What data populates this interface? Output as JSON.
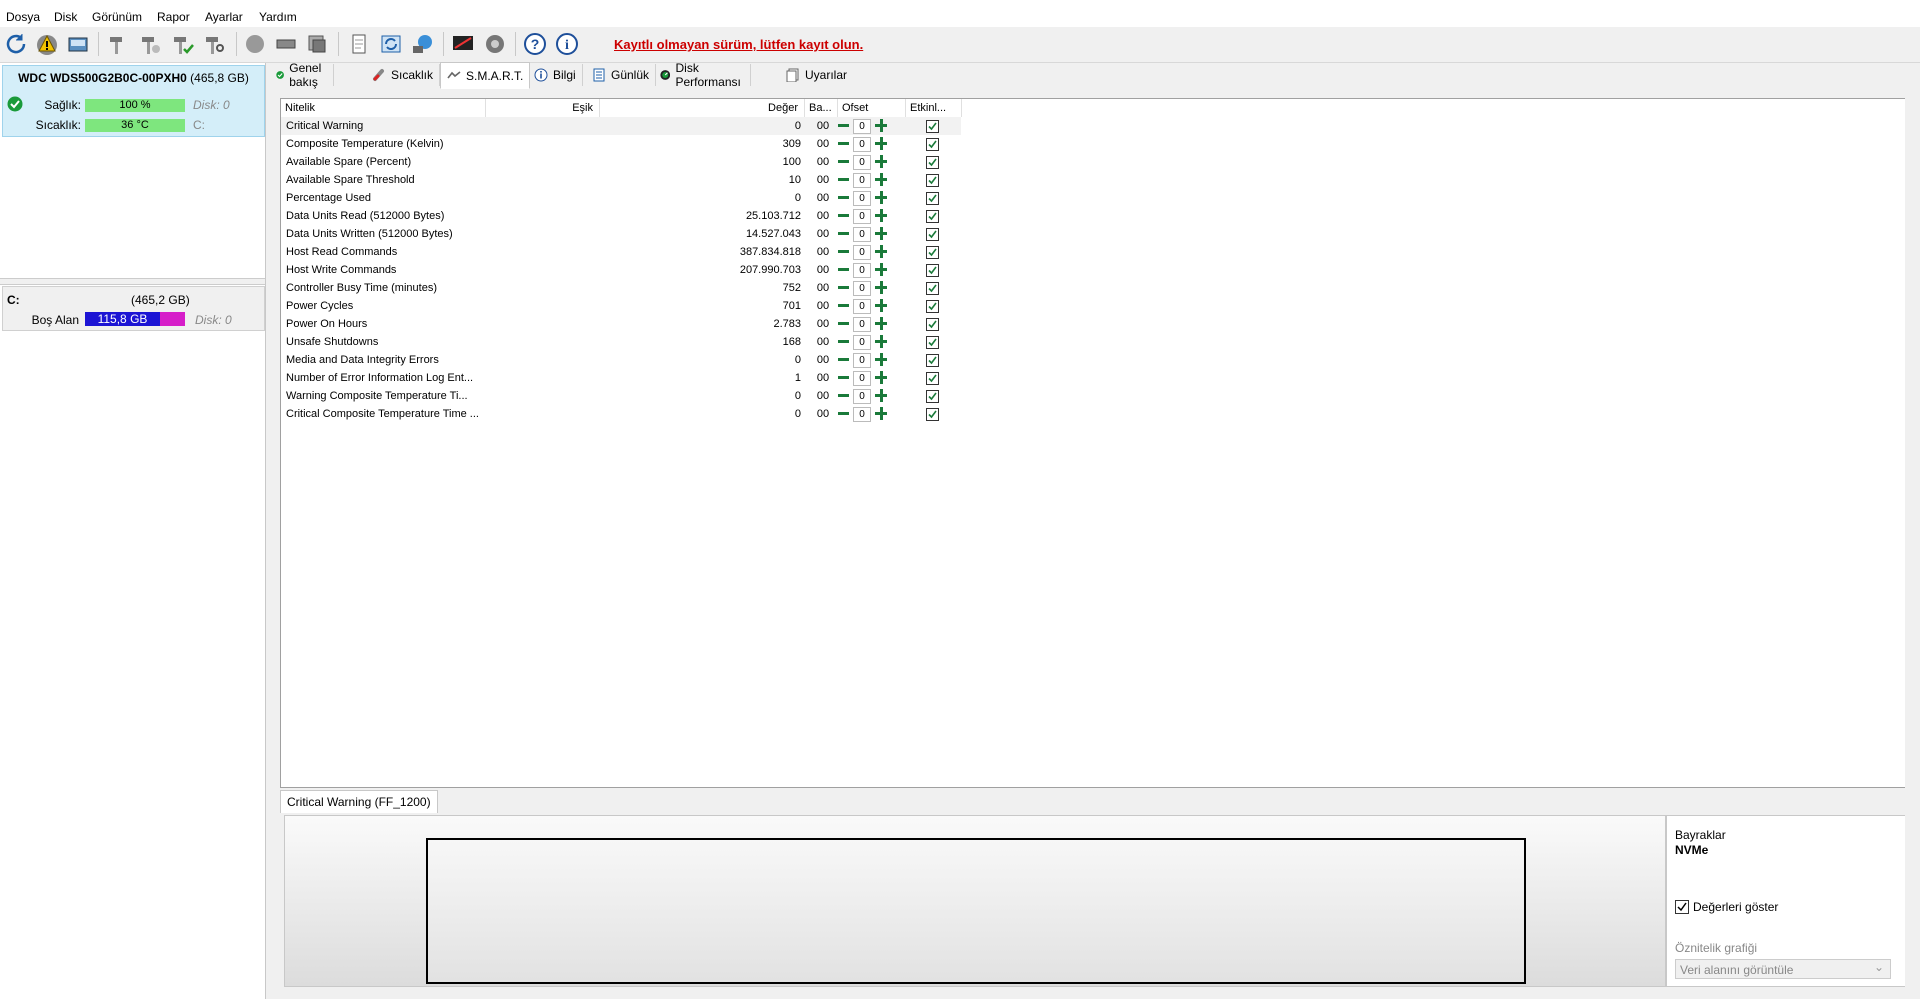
{
  "menu": [
    "Dosya",
    "Disk",
    "Görünüm",
    "Rapor",
    "Ayarlar",
    "Yardım"
  ],
  "unregistered": "Kayıtlı olmayan sürüm, lütfen kayıt olun.",
  "disk": {
    "model": "WDC WDS500G2B0C-00PXH0",
    "size": "(465,8 GB)",
    "health_label": "Sağlık:",
    "health_value": "100 %",
    "temp_label": "Sıcaklık:",
    "temp_value": "36 °C",
    "disk_num": "Disk: 0",
    "drive": "C:"
  },
  "volume": {
    "letter": "C:",
    "size": "(465,2 GB)",
    "free_label": "Boş Alan",
    "free_value": "115,8 GB",
    "used_fraction": 0.75,
    "disk_num": "Disk: 0"
  },
  "tabs": [
    "Genel bakış",
    "Sıcaklık",
    "S.M.A.R.T.",
    "Bilgi",
    "Günlük",
    "Disk Performansı",
    "Uyarılar"
  ],
  "table": {
    "headers": [
      "Nitelik",
      "Eşik",
      "Değer",
      "Ba...",
      "Ofset",
      "Etkinl..."
    ],
    "rows": [
      {
        "name": "Critical Warning",
        "value": "0",
        "ba": "00",
        "offset": "0"
      },
      {
        "name": "Composite Temperature (Kelvin)",
        "value": "309",
        "ba": "00",
        "offset": "0"
      },
      {
        "name": "Available Spare (Percent)",
        "value": "100",
        "ba": "00",
        "offset": "0"
      },
      {
        "name": "Available Spare Threshold",
        "value": "10",
        "ba": "00",
        "offset": "0"
      },
      {
        "name": "Percentage Used",
        "value": "0",
        "ba": "00",
        "offset": "0"
      },
      {
        "name": "Data Units Read (512000 Bytes)",
        "value": "25.103.712",
        "ba": "00",
        "offset": "0"
      },
      {
        "name": "Data Units Written (512000 Bytes)",
        "value": "14.527.043",
        "ba": "00",
        "offset": "0"
      },
      {
        "name": "Host Read Commands",
        "value": "387.834.818",
        "ba": "00",
        "offset": "0"
      },
      {
        "name": "Host Write Commands",
        "value": "207.990.703",
        "ba": "00",
        "offset": "0"
      },
      {
        "name": "Controller Busy Time (minutes)",
        "value": "752",
        "ba": "00",
        "offset": "0"
      },
      {
        "name": "Power Cycles",
        "value": "701",
        "ba": "00",
        "offset": "0"
      },
      {
        "name": "Power On Hours",
        "value": "2.783",
        "ba": "00",
        "offset": "0"
      },
      {
        "name": "Unsafe Shutdowns",
        "value": "168",
        "ba": "00",
        "offset": "0"
      },
      {
        "name": "Media and Data Integrity Errors",
        "value": "0",
        "ba": "00",
        "offset": "0"
      },
      {
        "name": "Number of Error Information Log Ent...",
        "value": "1",
        "ba": "00",
        "offset": "0"
      },
      {
        "name": "Warning Composite Temperature Ti...",
        "value": "0",
        "ba": "00",
        "offset": "0"
      },
      {
        "name": "Critical Composite Temperature Time ...",
        "value": "0",
        "ba": "00",
        "offset": "0"
      }
    ]
  },
  "bottom": {
    "tab_label": "Critical Warning (FF_1200)",
    "flags_label": "Bayraklar",
    "flags_value": "NVMe",
    "show_values_label": "Değerleri göster",
    "attr_graph_label": "Öznitelik grafiği",
    "dropdown_value": "Veri alanını görüntüle"
  },
  "colors": {
    "health_bar": "#7ee67e",
    "used_bar": "#1c14d4",
    "free_bar": "#d61ec9",
    "accent_green": "#1a7a3a"
  }
}
